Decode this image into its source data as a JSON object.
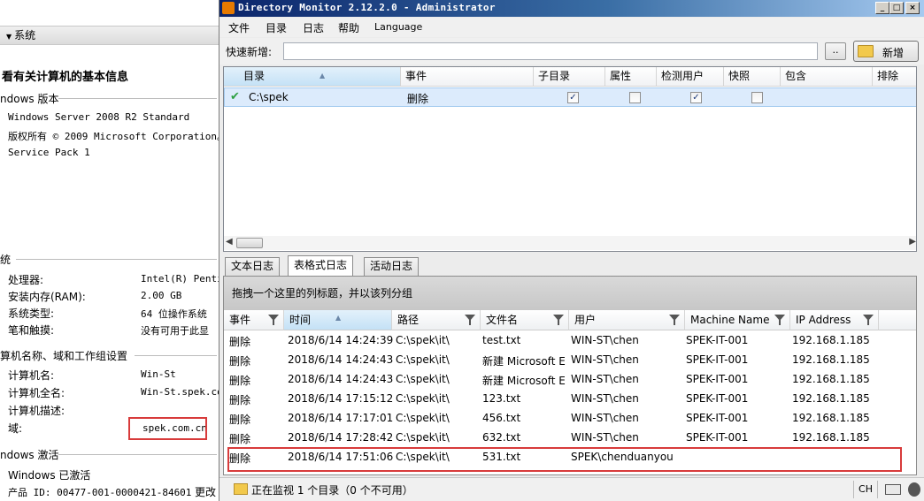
{
  "left_panel": {
    "section_label": "系统",
    "heading": "看有关计算机的基本信息",
    "windows_edition_header": "ndows 版本",
    "windows_edition": [
      "Windows Server 2008 R2 Standard",
      "版权所有 © 2009 Microsoft Corporation。",
      "Service Pack 1"
    ],
    "system_header": "统",
    "system_rows": [
      {
        "key": "处理器:",
        "value": "Intel(R) Penti"
      },
      {
        "key": "安装内存(RAM):",
        "value": "2.00 GB"
      },
      {
        "key": "系统类型:",
        "value": "64 位操作系统"
      },
      {
        "key": "笔和触摸:",
        "value": "没有可用于此显"
      }
    ],
    "computer_header": "算机名称、域和工作组设置",
    "computer_rows": [
      {
        "key": "计算机名:",
        "value": "Win-St"
      },
      {
        "key": "计算机全名:",
        "value": "Win-St.spek.co"
      },
      {
        "key": "计算机描述:",
        "value": ""
      },
      {
        "key": "域:",
        "value": "spek.com.cn"
      }
    ],
    "activation_header": "ndows 激活",
    "activation_status": "Windows 已激活",
    "product_id": "产品 ID: 00477-001-0000421-84601",
    "change_link": "更改"
  },
  "window": {
    "title": "Directory Monitor 2.12.2.0 - Administrator",
    "controls": {
      "minimize": "_",
      "maximize": "□",
      "close": "×"
    },
    "menu": [
      "文件",
      "目录",
      "日志",
      "帮助",
      "Language"
    ],
    "quick_add_label": "快速新增:",
    "quick_add_value": "",
    "browse_label": "..",
    "add_button": "新增",
    "dir_columns": [
      "目录",
      "事件",
      "子目录",
      "属性",
      "检测用户",
      "快照",
      "包含",
      "排除"
    ],
    "dir_rows": [
      {
        "path": "C:\\spek",
        "event": "删除",
        "subdirs": true,
        "attributes": false,
        "detect_user": true,
        "snapshot": false,
        "include": "",
        "exclude": ""
      }
    ],
    "tabs": [
      "文本日志",
      "表格式日志",
      "活动日志"
    ],
    "active_tab": "表格式日志",
    "group_hint": "拖拽一个这里的列标题，并以该列分组",
    "log_columns": [
      "事件",
      "时间",
      "路径",
      "文件名",
      "用户",
      "Machine Name",
      "IP Address"
    ],
    "log_rows": [
      [
        "删除",
        "2018/6/14 14:24:39",
        "C:\\spek\\it\\",
        "test.txt",
        "WIN-ST\\chen",
        "SPEK-IT-001",
        "192.168.1.185"
      ],
      [
        "删除",
        "2018/6/14 14:24:43",
        "C:\\spek\\it\\",
        "新建 Microsoft Ex...",
        "WIN-ST\\chen",
        "SPEK-IT-001",
        "192.168.1.185"
      ],
      [
        "删除",
        "2018/6/14 14:24:43",
        "C:\\spek\\it\\",
        "新建 Microsoft Ex...",
        "WIN-ST\\chen",
        "SPEK-IT-001",
        "192.168.1.185"
      ],
      [
        "删除",
        "2018/6/14 17:15:12",
        "C:\\spek\\it\\",
        "123.txt",
        "WIN-ST\\chen",
        "SPEK-IT-001",
        "192.168.1.185"
      ],
      [
        "删除",
        "2018/6/14 17:17:01",
        "C:\\spek\\it\\",
        "456.txt",
        "WIN-ST\\chen",
        "SPEK-IT-001",
        "192.168.1.185"
      ],
      [
        "删除",
        "2018/6/14 17:28:42",
        "C:\\spek\\it\\",
        "632.txt",
        "WIN-ST\\chen",
        "SPEK-IT-001",
        "192.168.1.185"
      ],
      [
        "删除",
        "2018/6/14 17:51:06",
        "C:\\spek\\it\\",
        "531.txt",
        "SPEK\\chenduanyou",
        "",
        ""
      ]
    ],
    "status_text": "正在监视 1 个目录（0 个不可用）",
    "input_lang": "CH"
  },
  "colors": {
    "highlight": "#d83b3b",
    "title_bar": "#0a246a",
    "check_ok": "#2ea043"
  }
}
